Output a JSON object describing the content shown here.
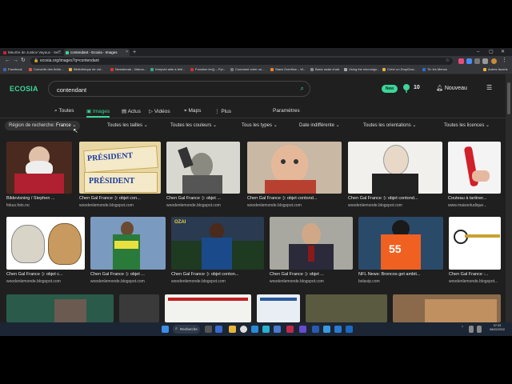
{
  "browser": {
    "tabs": [
      {
        "title": "Meurtre de Justice Vayaux - Sel..."
      },
      {
        "title": "contendant - Ecosia - Images"
      }
    ],
    "url": "ecosia.org/images?q=contendant",
    "bookmarks": [
      "Facebook",
      "Convertir des fichie...",
      "Bibliothèque de vid...",
      "Newsbreak - Videos...",
      "Keepvid aide à télé...",
      "Fonction len() – Pyt...",
      "Comment créer un...",
      "Stack Overflow – W...",
      "Basic radar chart",
      "Using the microsign...",
      "Créer un DropDow...",
      "Tk: les Menus",
      "Autres favoris"
    ]
  },
  "header": {
    "logo": "ECOSIA",
    "search_value": "contendant",
    "new_badge": "New",
    "tree_count": "10",
    "nouveau": "Nouveau"
  },
  "navtabs": {
    "toutes": "Toutes",
    "images": "Images",
    "actus": "Actus",
    "videos": "Vidéos",
    "maps": "Maps",
    "plus": "Plus",
    "parametres": "Paramètres"
  },
  "filters": {
    "region_label": "Région de recherche:",
    "region_value": "France",
    "sizes": "Toutes les tailles",
    "colors": "Toutes les couleurs",
    "types": "Tous les types",
    "date": "Date indifférente",
    "orientations": "Toutes les orientations",
    "licences": "Toutes les licences"
  },
  "results": {
    "row1": [
      {
        "caption": "Bildevisning / Stephen ...",
        "source": "fokus.foto.no"
      },
      {
        "caption": "Chen Gal France :): objet con...",
        "source": "woodenlemonde.blogspot.com"
      },
      {
        "caption": "Chen Gal France :): objet ...",
        "source": "woodenlemonde.blogspot.com"
      },
      {
        "caption": "Chen Gal France :): objet contond...",
        "source": "woodenlemonde.blogspot.com"
      },
      {
        "caption": "Chen Gal France :): objet contond...",
        "source": "woodenlemonde.blogspot.com"
      },
      {
        "caption": "Couteau à tartiner...",
        "source": "www.maisonludique..."
      }
    ],
    "row2": [
      {
        "caption": "Chen Gal France :): objet c...",
        "source": "woodenlemonde.blogspot.com"
      },
      {
        "caption": "Chen Gal France :): objet ...",
        "source": "woodenlemonde.blogspot.com"
      },
      {
        "caption": "Chen Gal France :): objet conton...",
        "source": "woodenlemonde.blogspot.com"
      },
      {
        "caption": "Chen Gal France :): objet ...",
        "source": "woodenlemonde.blogspot.com"
      },
      {
        "caption": "NFL News: Broncos get ambit...",
        "source": "bolavip.com"
      },
      {
        "caption": "Chen Gal France :...",
        "source": "woodenlemonde.blogspot..."
      }
    ],
    "butter_brand": "PRÉSIDENT",
    "jersey_number": "55",
    "banner_text": "OZAI"
  },
  "taskbar": {
    "search": "Recherche",
    "time": "07:33",
    "date": "08/02/2022"
  }
}
